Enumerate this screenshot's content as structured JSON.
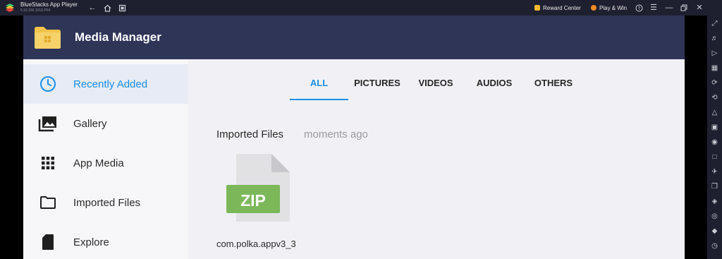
{
  "window": {
    "title": "BlueStacks App Player",
    "version": "5.10.150.1016  P64",
    "reward_center": "Reward Center",
    "play_win": "Play & Win",
    "colors": {
      "reward": "#f5b82e",
      "play_win": "#f08a24"
    }
  },
  "app": {
    "title": "Media Manager",
    "colors": {
      "header": "#2e3557",
      "accent": "#1a8fe8",
      "folder": "#f3c44b"
    }
  },
  "sidebar": {
    "items": [
      {
        "label": "Recently Added",
        "icon": "clock-icon",
        "active": true
      },
      {
        "label": "Gallery",
        "icon": "gallery-icon",
        "active": false
      },
      {
        "label": "App Media",
        "icon": "grid-icon",
        "active": false
      },
      {
        "label": "Imported Files",
        "icon": "folder-icon",
        "active": false
      },
      {
        "label": "Explore",
        "icon": "sd-card-icon",
        "active": false
      }
    ]
  },
  "tabs": [
    {
      "label": "ALL",
      "active": true
    },
    {
      "label": "PICTURES",
      "active": false
    },
    {
      "label": "VIDEOS",
      "active": false
    },
    {
      "label": "AUDIOS",
      "active": false
    },
    {
      "label": "OTHERS",
      "active": false
    }
  ],
  "content": {
    "section_title": "Imported Files",
    "section_time": "moments ago",
    "files": [
      {
        "name": "com.polka.appv3_3",
        "type_label": "ZIP",
        "icon": "zip-file-icon"
      }
    ]
  },
  "toolbar_icons": [
    "expand-icon",
    "volume-icon",
    "record-icon",
    "keyboard-icon",
    "rotate-icon",
    "sync-icon",
    "gamepad-icon",
    "apk-icon",
    "screenshot-icon",
    "folder-icon",
    "airplane-icon",
    "multi-instance-icon",
    "eco-icon",
    "location-icon",
    "layers-icon",
    "macro-icon"
  ]
}
